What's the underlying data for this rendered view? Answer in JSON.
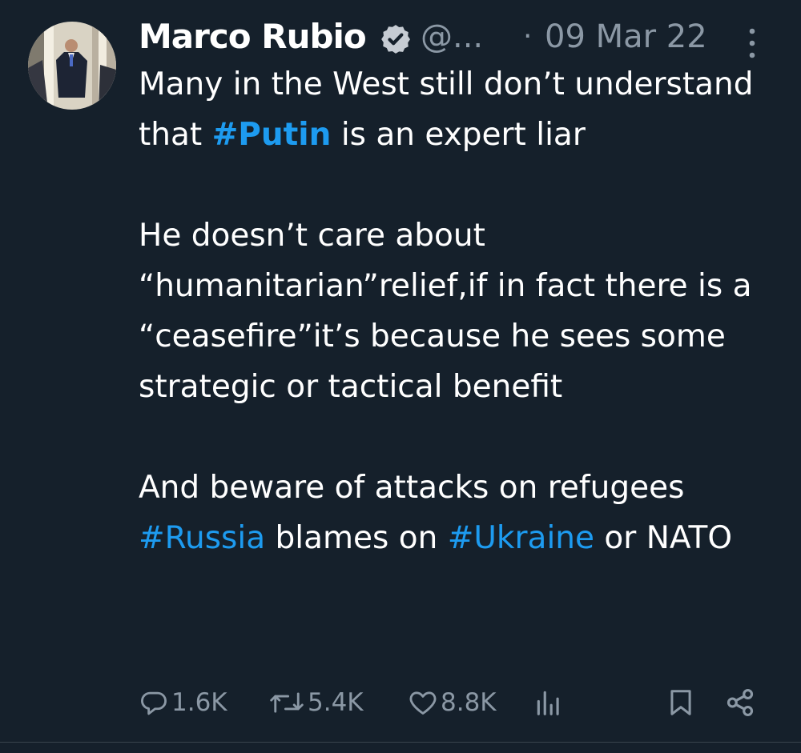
{
  "author": {
    "name": "Marco Rubio",
    "handle": "@...",
    "separator": "·",
    "date": "09 Mar 22",
    "verified": true
  },
  "tweet": {
    "p1": {
      "t1": "Many in the West still don’t understand that ",
      "tag": "#Putin",
      "t2": " is an expert liar"
    },
    "p2": {
      "text": "He doesn’t care about “humanitarian”relief,if in fact there is a “ceasefire”it’s because he sees some strategic or tactical benefit"
    },
    "p3": {
      "t1": "And beware of attacks on refugees ",
      "tag1": "#Russia",
      "t2": " blames on ",
      "tag2": "#Ukraine",
      "t3": " or NATO"
    }
  },
  "actions": {
    "reply_count": "1.6K",
    "retweet_count": "5.4K",
    "like_count": "8.8K"
  },
  "colors": {
    "background": "#15202b",
    "text": "#ffffff",
    "muted": "#8b98a5",
    "hashtag": "#1d9bf0"
  },
  "icons": [
    "verified-badge-icon",
    "more-options-icon",
    "reply-icon",
    "retweet-icon",
    "like-icon",
    "views-icon",
    "bookmark-icon",
    "share-icon"
  ]
}
